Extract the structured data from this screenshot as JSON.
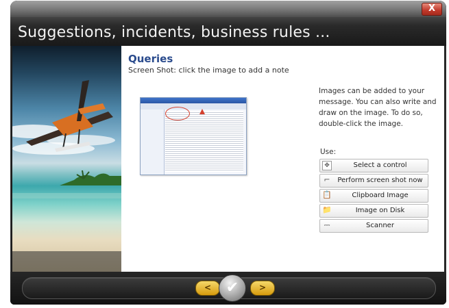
{
  "window": {
    "title": "Suggestions, incidents, business rules ...",
    "close_label": "X"
  },
  "panel": {
    "heading": "Queries",
    "subheading": "Screen Shot: click the image to add a note",
    "info_text": "Images can be added to your message. You can also write and draw on the image. To do so, double-click the image.",
    "use_label": "Use:"
  },
  "buttons": [
    {
      "label": "Select a control",
      "icon": "target-icon"
    },
    {
      "label": "Perform screen shot now",
      "icon": "crop-icon"
    },
    {
      "label": "Clipboard Image",
      "icon": "clipboard-icon"
    },
    {
      "label": "Image on Disk",
      "icon": "folder-icon"
    },
    {
      "label": "Scanner",
      "icon": "scanner-icon"
    }
  ],
  "navigation": {
    "prev_label": "<",
    "ok_label": "✔",
    "next_label": ">"
  },
  "colors": {
    "accent_blue": "#2a4b8d",
    "nav_gold": "#e0a81a",
    "close_red": "#c0392b"
  }
}
